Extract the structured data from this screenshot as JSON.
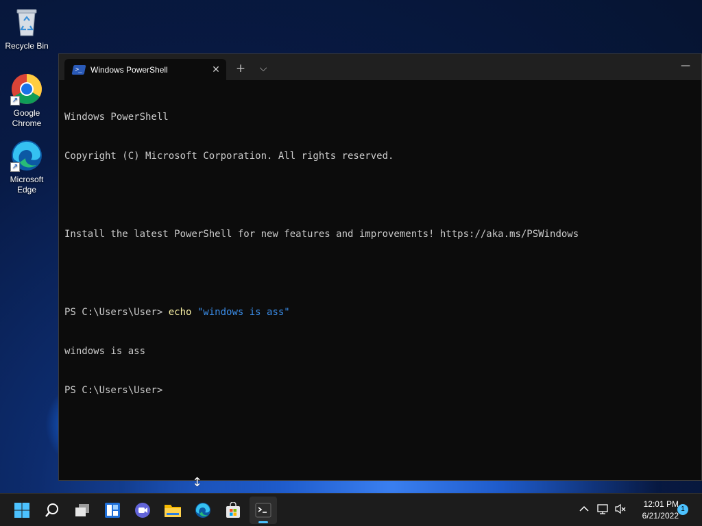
{
  "desktop": {
    "icons": [
      {
        "label": "Recycle Bin",
        "icon": "recycle-bin-icon"
      },
      {
        "label": "Google Chrome",
        "icon": "chrome-icon"
      },
      {
        "label": "Microsoft Edge",
        "icon": "edge-icon"
      }
    ]
  },
  "terminal": {
    "tab_title": "Windows PowerShell",
    "tab_close": "✕",
    "new_tab": "+",
    "dropdown": "⌵",
    "minimize": "—",
    "lines": {
      "l1": "Windows PowerShell",
      "l2": "Copyright (C) Microsoft Corporation. All rights reserved.",
      "l3": "Install the latest PowerShell for new features and improvements! https://aka.ms/PSWindows",
      "prompt1": "PS C:\\Users\\User> ",
      "cmd": "echo",
      "arg": "\"windows is ass\"",
      "output": "windows is ass",
      "prompt2": "PS C:\\Users\\User>"
    }
  },
  "taskbar": {
    "items": [
      "start-icon",
      "search-icon",
      "task-view-icon",
      "widgets-icon",
      "chat-icon",
      "file-explorer-icon",
      "edge-icon",
      "store-icon",
      "terminal-icon"
    ],
    "clock_time": "12:01 PM",
    "clock_date": "6/21/2022",
    "notification_count": "1"
  },
  "colors": {
    "accent": "#4cc2ff",
    "console_bg": "#0c0c0c",
    "command": "#f9f1a5",
    "string": "#3b8eea"
  }
}
